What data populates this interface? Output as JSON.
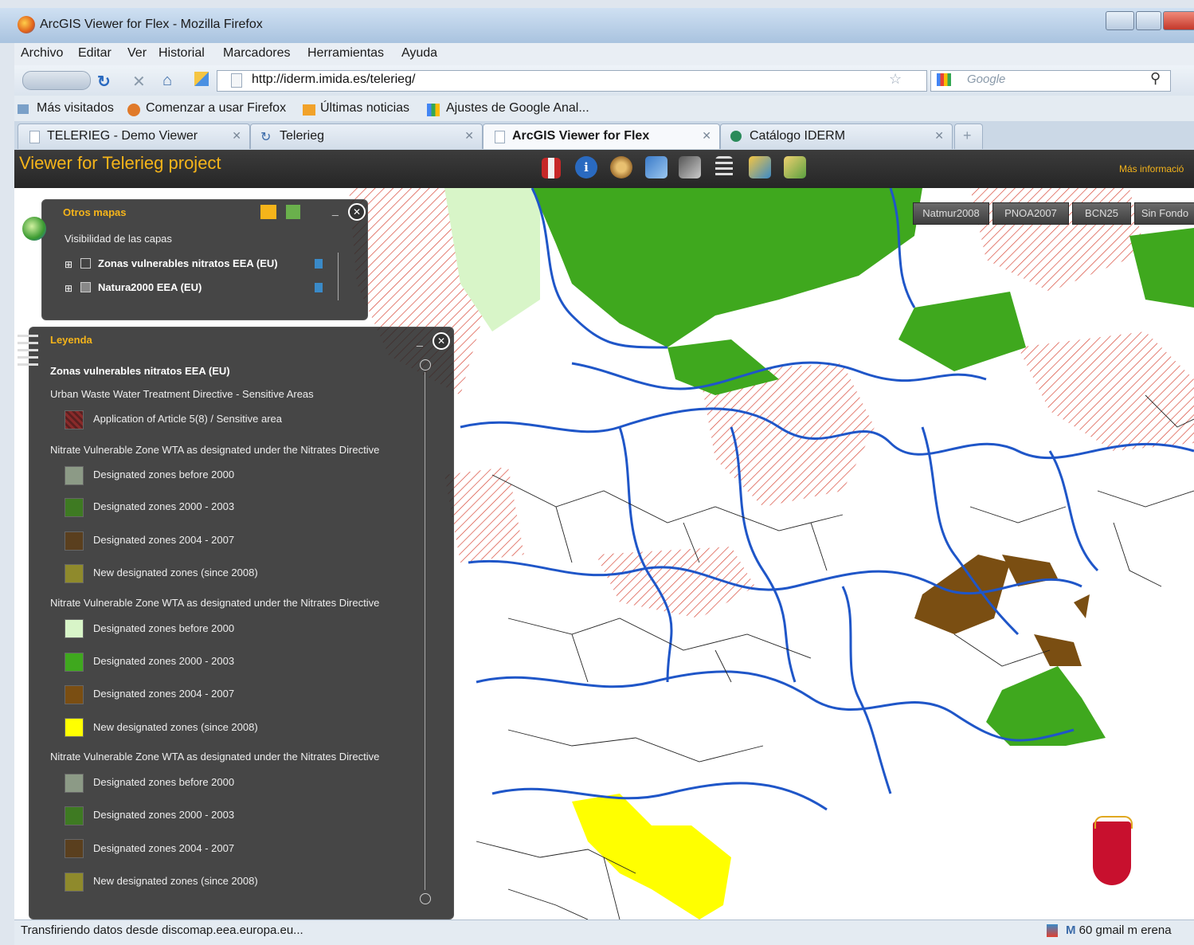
{
  "window": {
    "title": "ArcGIS Viewer for Flex - Mozilla Firefox"
  },
  "menu": [
    "Archivo",
    "Editar",
    "Ver",
    "Historial",
    "Marcadores",
    "Herramientas",
    "Ayuda"
  ],
  "nav": {
    "url": "http://iderm.imida.es/telerieg/",
    "search_placeholder": "Google"
  },
  "bookmarks": [
    "Más visitados",
    "Comenzar a usar Firefox",
    "Últimas noticias",
    "Ajustes de Google Anal..."
  ],
  "tabs": [
    {
      "label": "TELERIEG - Demo Viewer",
      "active": false
    },
    {
      "label": "Telerieg",
      "active": false
    },
    {
      "label": "ArcGIS Viewer for Flex",
      "active": true
    },
    {
      "label": "Catálogo IDERM",
      "active": false
    }
  ],
  "app": {
    "title": "Viewer for Telerieg project",
    "more_info": "Más informació"
  },
  "basemaps": [
    "Natmur2008",
    "PNOA2007",
    "BCN25",
    "Sin Fondo"
  ],
  "layers_panel": {
    "title": "Otros mapas",
    "subtitle": "Visibilidad de las capas",
    "layers": [
      "Zonas vulnerables nitratos EEA (EU)",
      "Natura2000 EEA (EU)"
    ]
  },
  "legend_panel": {
    "title": "Leyenda",
    "layer_name": "Zonas vulnerables nitratos EEA (EU)",
    "group1_title": "Urban Waste Water Treatment Directive - Sensitive Areas",
    "group1_item": "Application of Article 5(8) / Sensitive area",
    "groups": [
      {
        "title": "Nitrate Vulnerable Zone WTA as designated under the Nitrates Directive",
        "items": [
          {
            "label": "Designated zones before 2000",
            "color": "#8c9a86"
          },
          {
            "label": "Designated zones 2000 - 2003",
            "color": "#3e7a22"
          },
          {
            "label": "Designated zones 2004 - 2007",
            "color": "#5a3f1e"
          },
          {
            "label": "New designated zones (since 2008)",
            "color": "#8f8a2c"
          }
        ]
      },
      {
        "title": "Nitrate Vulnerable Zone WTA as designated under the Nitrates Directive",
        "items": [
          {
            "label": "Designated zones before 2000",
            "color": "#d8f5c8"
          },
          {
            "label": "Designated zones 2000 - 2003",
            "color": "#3fa81e"
          },
          {
            "label": "Designated zones 2004 - 2007",
            "color": "#7a4e12"
          },
          {
            "label": "New designated zones (since 2008)",
            "color": "#ffff00"
          }
        ]
      },
      {
        "title": "Nitrate Vulnerable Zone WTA as designated under the Nitrates Directive",
        "items": [
          {
            "label": "Designated zones before 2000",
            "color": "#8c9a86"
          },
          {
            "label": "Designated zones 2000 - 2003",
            "color": "#3e7a22"
          },
          {
            "label": "Designated zones 2004 - 2007",
            "color": "#5a3f1e"
          },
          {
            "label": "New designated zones (since 2008)",
            "color": "#8f8a2c"
          }
        ]
      }
    ]
  },
  "status": {
    "text": "Transfiriendo datos desde discomap.eea.europa.eu...",
    "gmail": "60 gmail m erena"
  }
}
